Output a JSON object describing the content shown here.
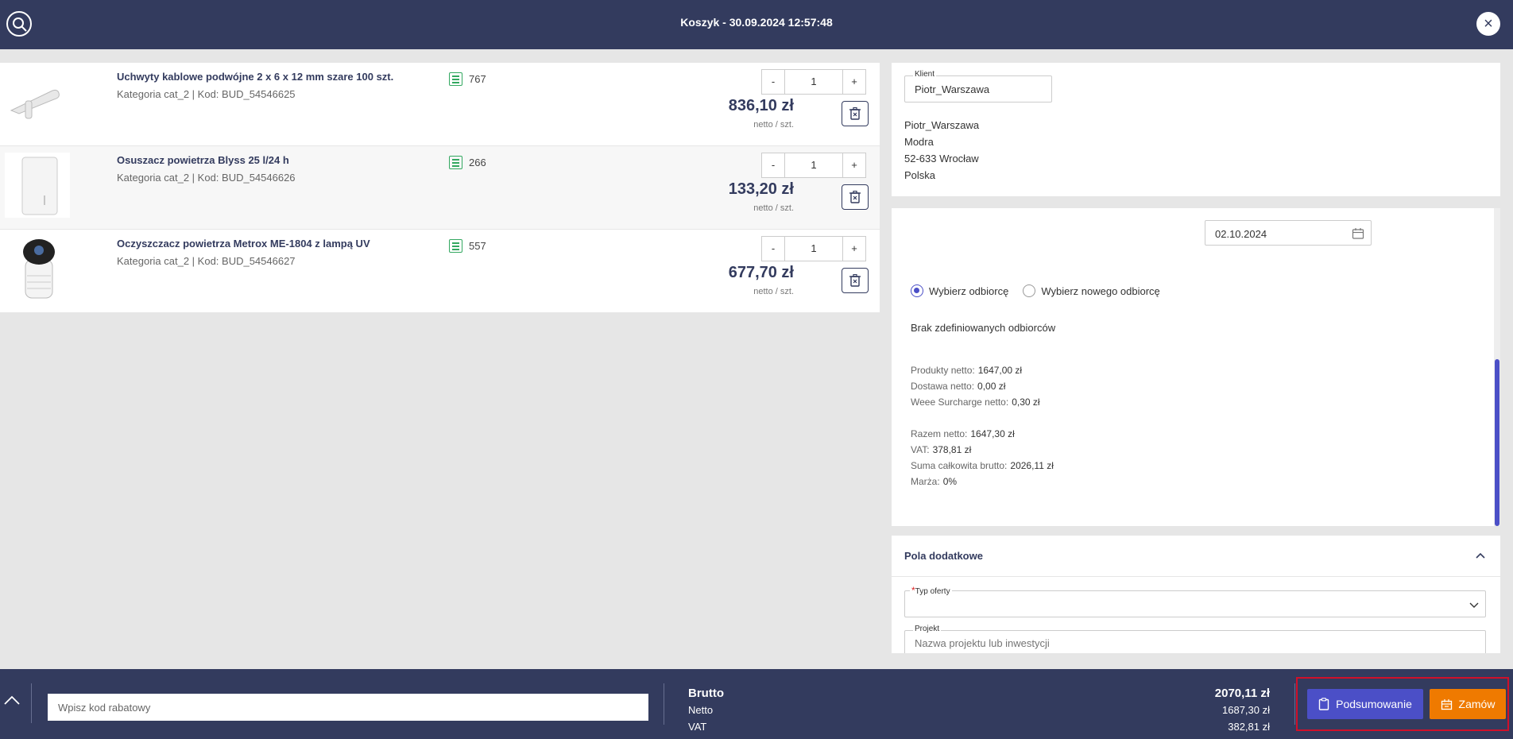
{
  "header": {
    "title": "Koszyk - 30.09.2024 12:57:48"
  },
  "products": [
    {
      "name": "Uchwyty kablowe podwójne 2 x 6 x 12 mm szare 100 szt.",
      "meta": "Kategoria cat_2 | Kod: BUD_54546625",
      "stock": "767",
      "qty": "1",
      "price": "836,10 zł",
      "unit": "netto / szt."
    },
    {
      "name": "Osuszacz powietrza Blyss 25 l/24 h",
      "meta": "Kategoria cat_2 | Kod: BUD_54546626",
      "stock": "266",
      "qty": "1",
      "price": "133,20 zł",
      "unit": "netto / szt."
    },
    {
      "name": "Oczyszczacz powietrza Metrox ME-1804 z lampą UV",
      "meta": "Kategoria cat_2 | Kod: BUD_54546627",
      "stock": "557",
      "qty": "1",
      "price": "677,70 zł",
      "unit": "netto / szt."
    }
  ],
  "qty_controls": {
    "minus": "-",
    "plus": "+"
  },
  "client": {
    "label": "Klient",
    "value": "Piotr_Warszawa",
    "address": [
      "Piotr_Warszawa",
      "Modra",
      "52-633 Wrocław",
      "Polska"
    ]
  },
  "order": {
    "date": "02.10.2024",
    "radio_existing": "Wybierz odbiorcę",
    "radio_new": "Wybierz nowego odbiorcę",
    "no_recipients": "Brak zdefiniowanych odbiorców",
    "summary": {
      "products_label": "Produkty netto:",
      "products_value": "1647,00 zł",
      "delivery_label": "Dostawa netto:",
      "delivery_value": "0,00 zł",
      "weee_label": "Weee Surcharge netto:",
      "weee_value": "0,30 zł",
      "total_net_label": "Razem netto:",
      "total_net_value": "1647,30 zł",
      "vat_label": "VAT:",
      "vat_value": "378,81 zł",
      "gross_label": "Suma całkowita brutto:",
      "gross_value": "2026,11 zł",
      "margin_label": "Marża:",
      "margin_value": "0%"
    }
  },
  "extra": {
    "title": "Pola dodatkowe",
    "offer_type_label": "Typ oferty",
    "required_mark": "*",
    "project_label": "Projekt",
    "project_placeholder": "Nazwa projektu lub inwestycji"
  },
  "footer": {
    "coupon_placeholder": "Wpisz kod rabatowy",
    "gross_label": "Brutto",
    "gross_value": "2070,11 zł",
    "net_label": "Netto",
    "net_value": "1687,30 zł",
    "vat_label": "VAT",
    "vat_value": "382,81 zł",
    "summary_button": "Podsumowanie",
    "order_button": "Zamów"
  },
  "colors": {
    "navy": "#333b5e",
    "accent": "#4b4fc7",
    "orange": "#ef7a00",
    "stock_green": "#33a860",
    "highlight_red": "#d0102a"
  }
}
